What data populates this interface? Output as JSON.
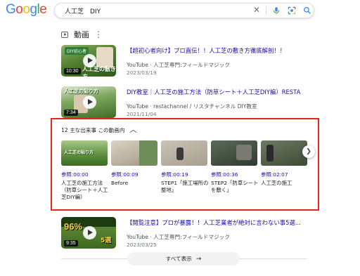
{
  "search": {
    "query": "人工芝　DIY"
  },
  "videos_section": {
    "title": "動画"
  },
  "videos": [
    {
      "title": "【超初心者向け】プロ直伝！！人工芝の敷き方徹底解剖！！",
      "meta": "YouTube · 人工芝専門:フィールドマジック",
      "date": "2023/03/19",
      "duration": "10:30",
      "thumb_caption": "人工芝の敷き方"
    },
    {
      "title": "DIY教室｜人工芝の施工方法（防草シート＋人工芝DIY編）RESTA",
      "meta": "YouTube · restachannel / リスタチャンネル DIY教室",
      "date": "2021/11/04",
      "duration": "7:34"
    },
    {
      "title": "【閲覧注意】プロが暴露！！人工芝業者が絶対に言わない事5選...",
      "meta": "YouTube · 人工芝専門:フィールドマジック",
      "date": "2023/03/25",
      "duration": "9:35",
      "thumb_caption": "96%",
      "thumb_badge": "5選"
    }
  ],
  "key_moments": {
    "header": "12 主な出来事 この動画内",
    "items": [
      {
        "time": "参照:00:00",
        "desc": "人工芝の施工方法（防草シート＋人工芝DIY編）"
      },
      {
        "time": "参照:00:09",
        "desc": "Before"
      },
      {
        "time": "参照:00:19",
        "desc": "STEP1「施工場所の整地」"
      },
      {
        "time": "参照:00:36",
        "desc": "STEP2「防草シートを敷く」"
      },
      {
        "time": "参照:02:07",
        "desc": "人工芝の施工"
      }
    ]
  },
  "show_all": {
    "label": "すべて表示"
  },
  "logo": {
    "text": "Google",
    "colors": [
      "#4285F4",
      "#EA4335",
      "#FBBC05",
      "#4285F4",
      "#34A853",
      "#EA4335"
    ]
  },
  "icons": {
    "clear": "close-icon",
    "mic": "mic-icon",
    "lens": "lens-icon",
    "search": "search-icon",
    "more": "more-vert-icon",
    "collapse": "chevron-up-icon",
    "next": "chevron-right-icon",
    "show_all_arrow": "arrow-right-icon"
  },
  "colors": {
    "link": "#1a0dab",
    "highlight_border": "#e5271b"
  }
}
